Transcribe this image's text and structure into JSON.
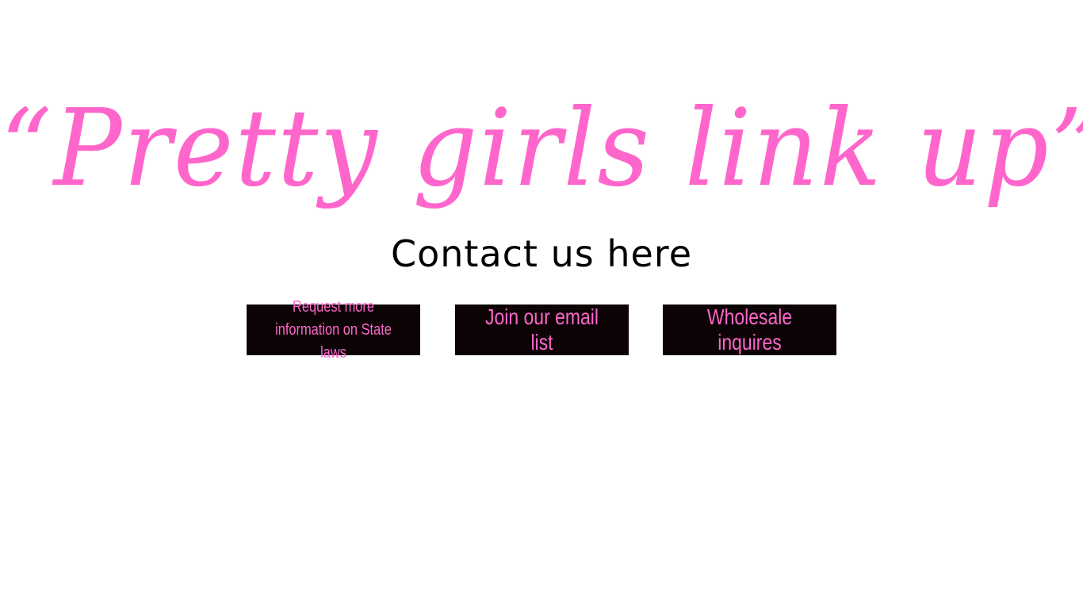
{
  "hero": {
    "title": "“Pretty girls link up”"
  },
  "contact": {
    "heading": "Contact us here"
  },
  "buttons": {
    "state_laws_label": "Request more information on State laws",
    "email_list_label": "Join our email list",
    "wholesale_label": "Wholesale inquires"
  },
  "colors": {
    "accent_pink": "#ff66cc",
    "button_background": "#0c0404",
    "heading_text": "#000000",
    "page_background": "#ffffff"
  }
}
